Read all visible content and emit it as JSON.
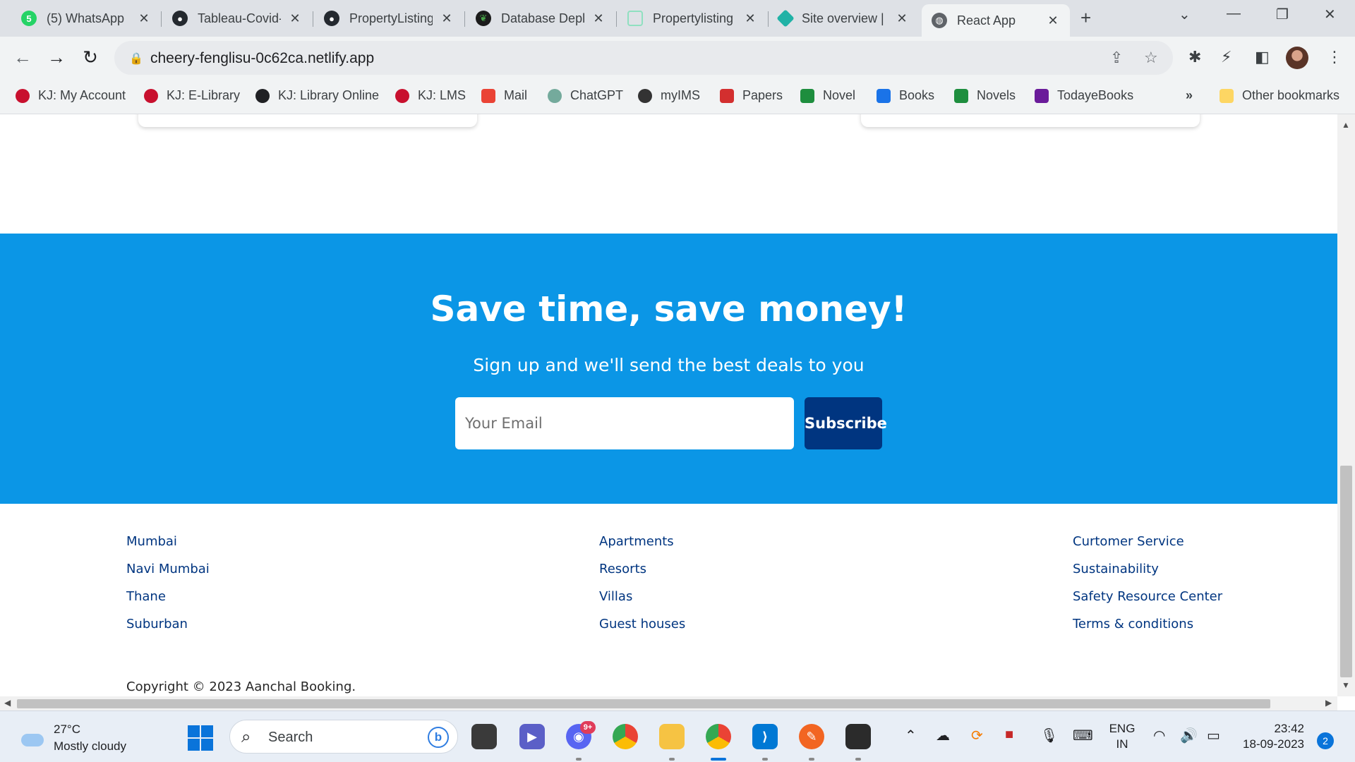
{
  "browser": {
    "tabs": [
      {
        "title": "(5) WhatsApp",
        "icon": "whatsapp-icon",
        "color": "#25d366",
        "glyph": "5"
      },
      {
        "title": "Tableau-Covid-",
        "icon": "github-icon",
        "color": "#24292f",
        "glyph": "●"
      },
      {
        "title": "PropertyListing",
        "icon": "github-icon",
        "color": "#24292f",
        "glyph": "●"
      },
      {
        "title": "Database Depl",
        "icon": "mongodb-icon",
        "color": "#1b1b1b",
        "glyph": "❦"
      },
      {
        "title": "Propertylisting",
        "icon": "page-icon",
        "color": "#8fe0c0",
        "glyph": ""
      },
      {
        "title": "Site overview |",
        "icon": "netlify-icon",
        "color": "#20b2a6",
        "glyph": "◆"
      },
      {
        "title": "React App",
        "icon": "globe-icon",
        "color": "#5f6368",
        "glyph": "◍"
      }
    ],
    "url": "cheery-fenglisu-0c62ca.netlify.app",
    "bookmarks": [
      {
        "label": "KJ: My Account",
        "color": "#c8102e"
      },
      {
        "label": "KJ: E-Library",
        "color": "#c8102e"
      },
      {
        "label": "KJ: Library Online",
        "color": "#202124"
      },
      {
        "label": "KJ: LMS",
        "color": "#c8102e"
      },
      {
        "label": "Mail",
        "color": "#ea4335"
      },
      {
        "label": "ChatGPT",
        "color": "#74aa9c"
      },
      {
        "label": "myIMS",
        "color": "#333333"
      },
      {
        "label": "Papers",
        "color": "#d32f2f"
      },
      {
        "label": "Novel",
        "color": "#1e8e3e"
      },
      {
        "label": "Books",
        "color": "#1a73e8"
      },
      {
        "label": "Novels",
        "color": "#1e8e3e"
      },
      {
        "label": "TodayeBooks",
        "color": "#6a1b9a"
      }
    ],
    "overflow": "»",
    "other_bookmarks": "Other bookmarks"
  },
  "newsletter": {
    "title": "Save time, save money!",
    "subtitle": "Sign up and we'll send the best deals to you",
    "email_placeholder": "Your Email",
    "button": "Subscribe",
    "bg_color": "#0b96e6",
    "button_color": "#003580"
  },
  "footer": {
    "col1": [
      "Mumbai",
      "Navi Mumbai",
      "Thane",
      "Suburban"
    ],
    "col2": [
      "Apartments",
      "Resorts",
      "Villas",
      "Guest houses"
    ],
    "col3": [
      "Curtomer Service",
      "Sustainability",
      "Safety Resource Center",
      "Terms & conditions"
    ],
    "copyright": "Copyright © 2023 Aanchal Booking."
  },
  "taskbar": {
    "weather_temp": "27°C",
    "weather_desc": "Mostly cloudy",
    "search_label": "Search",
    "discord_badge": "9+",
    "lang_top": "ENG",
    "lang_bottom": "IN",
    "time": "23:42",
    "date": "18-09-2023",
    "notifications": "2"
  }
}
